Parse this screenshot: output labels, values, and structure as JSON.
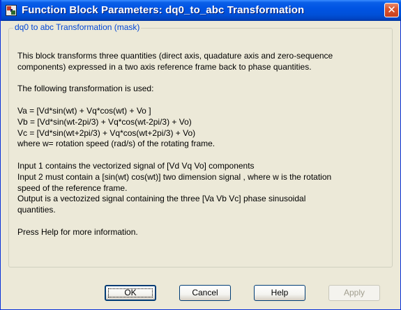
{
  "window": {
    "title": "Function Block Parameters: dq0_to_abc Transformation",
    "close_glyph": "✕",
    "icon": "simulink-block-icon"
  },
  "group": {
    "legend": "dq0 to abc Transformation (mask)",
    "lines": [
      "This block transforms  three quantities  (direct axis, quadature axis and zero-sequence",
      "components)  expressed in a two axis reference frame back to phase quantities.",
      "",
      "The following transformation is used:",
      "",
      "Va = [Vd*sin(wt) +  Vq*cos(wt)  +  Vo ]",
      "Vb = [Vd*sin(wt-2pi/3)  + Vq*cos(wt-2pi/3)  + Vo)",
      "Vc = [Vd*sin(wt+2pi/3) + Vq*cos(wt+2pi/3)  + Vo)",
      "where w=  rotation speed (rad/s) of the rotating frame.",
      "",
      "Input 1 contains  the vectorized signal of [Vd Vq  Vo] components",
      "Input 2 must contain a  [sin(wt)  cos(wt)] two dimension signal , where w is the rotation",
      "speed  of the reference frame.",
      "Output is a vectozized signal containing the three  [Va Vb Vc] phase sinusoidal",
      "quantities.",
      "",
      "Press Help for more information."
    ]
  },
  "buttons": {
    "ok": "OK",
    "cancel": "Cancel",
    "help": "Help",
    "apply": "Apply"
  },
  "colors": {
    "title_bar": "#0054E3",
    "dialog_bg": "#ECE9D8",
    "legend_text": "#0046D5",
    "close_button": "#D9542E"
  }
}
